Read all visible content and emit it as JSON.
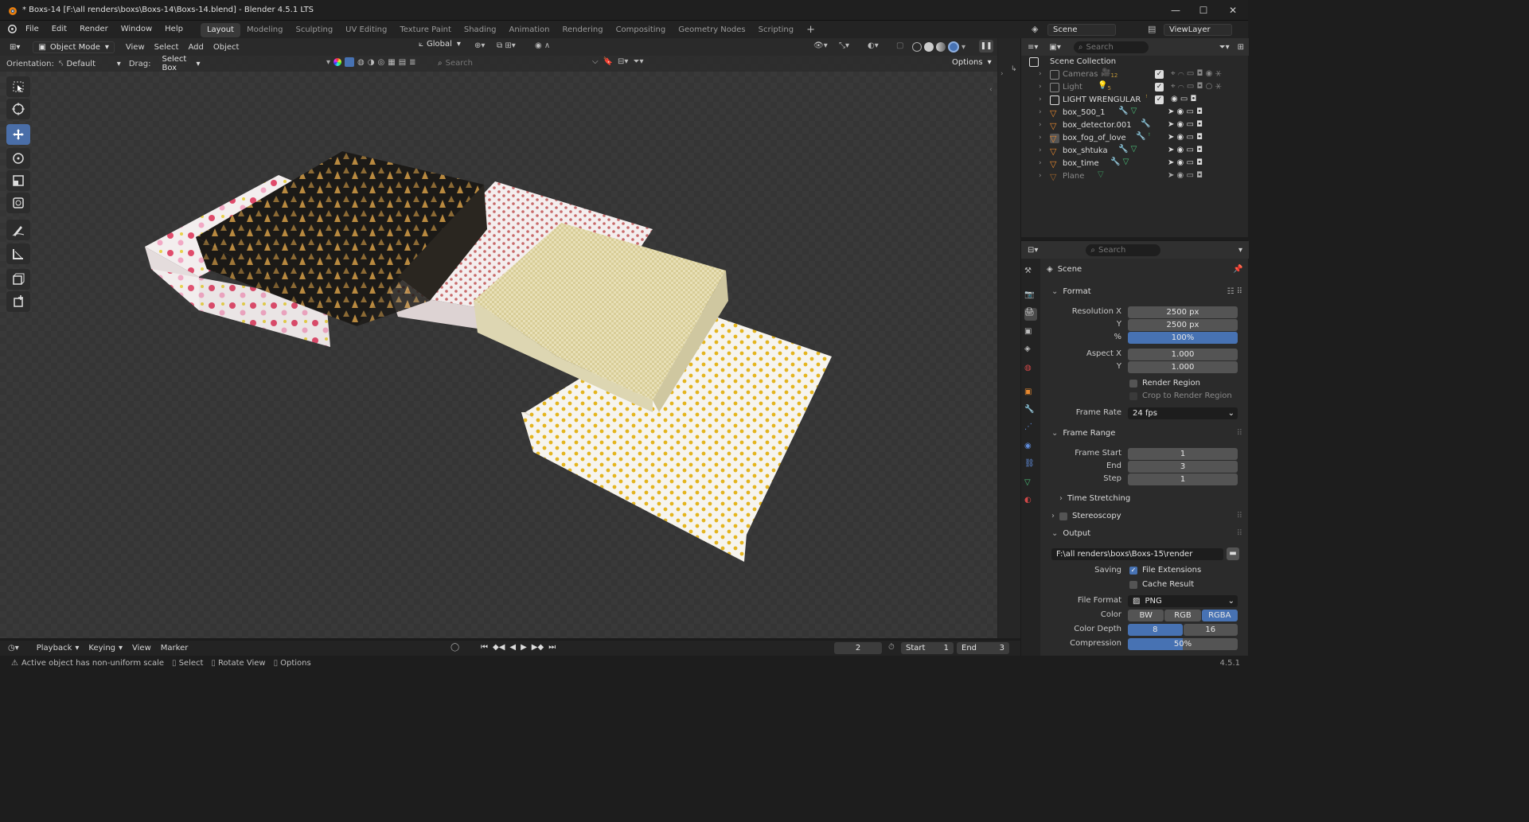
{
  "window": {
    "title": "* Boxs-14 [F:\\all renders\\boxs\\Boxs-14\\Boxs-14.blend] - Blender 4.5.1 LTS"
  },
  "menu": [
    "File",
    "Edit",
    "Render",
    "Window",
    "Help"
  ],
  "workspaces": [
    "Layout",
    "Modeling",
    "Sculpting",
    "UV Editing",
    "Texture Paint",
    "Shading",
    "Animation",
    "Rendering",
    "Compositing",
    "Geometry Nodes",
    "Scripting"
  ],
  "active_workspace": "Layout",
  "scene_selector": "Scene",
  "viewlayer_selector": "ViewLayer",
  "viewport": {
    "mode": "Object Mode",
    "menus": [
      "View",
      "Select",
      "Add",
      "Object"
    ],
    "transform_orientation": "Global",
    "orientation_label": "Orientation:",
    "orientation_value": "Default",
    "drag_label": "Drag:",
    "drag_value": "Select Box",
    "search_placeholder": "Search",
    "options_label": "Options"
  },
  "outliner": {
    "search_placeholder": "Search",
    "root": "Scene Collection",
    "items": [
      {
        "name": "Cameras",
        "badge": "12",
        "dim": true
      },
      {
        "name": "Light",
        "badge": "5",
        "dim": true
      },
      {
        "name": "LIGHT WRENGULAR",
        "dim": false
      },
      {
        "name": "box_500_1",
        "dim": false
      },
      {
        "name": "box_detector.001",
        "dim": false
      },
      {
        "name": "box_fog_of_love",
        "dim": false
      },
      {
        "name": "box_shtuka",
        "dim": false
      },
      {
        "name": "box_time",
        "dim": false
      },
      {
        "name": "Plane",
        "dim": true
      }
    ]
  },
  "properties": {
    "search_placeholder": "Search",
    "context": "Scene",
    "format": {
      "title": "Format",
      "res_x_label": "Resolution X",
      "res_x": "2500 px",
      "res_y_label": "Y",
      "res_y": "2500 px",
      "pct_label": "%",
      "pct": "100%",
      "aspect_x_label": "Aspect X",
      "aspect_x": "1.000",
      "aspect_y_label": "Y",
      "aspect_y": "1.000",
      "render_region": "Render Region",
      "crop_region": "Crop to Render Region",
      "frame_rate_label": "Frame Rate",
      "frame_rate": "24 fps"
    },
    "frame_range": {
      "title": "Frame Range",
      "start_label": "Frame Start",
      "start": "1",
      "end_label": "End",
      "end": "3",
      "step_label": "Step",
      "step": "1"
    },
    "time_stretching": "Time Stretching",
    "stereoscopy": "Stereoscopy",
    "output": {
      "title": "Output",
      "path": "F:\\all renders\\boxs\\Boxs-15\\render",
      "saving_label": "Saving",
      "file_extensions": "File Extensions",
      "cache_result": "Cache Result",
      "file_format_label": "File Format",
      "file_format": "PNG",
      "color_label": "Color",
      "color_opts": [
        "BW",
        "RGB",
        "RGBA"
      ],
      "color_active": "RGBA",
      "depth_label": "Color Depth",
      "depth_opts": [
        "8",
        "16"
      ],
      "depth_active": "8",
      "compression_label": "Compression",
      "compression": "50%"
    }
  },
  "timeline": {
    "menus": [
      "Playback",
      "Keying",
      "View",
      "Marker"
    ],
    "current_frame": "2",
    "start_label": "Start",
    "start": "1",
    "end_label": "End",
    "end": "3"
  },
  "status": {
    "warning": "Active object has non-uniform scale",
    "hints": [
      "Select",
      "Rotate View",
      "Options"
    ],
    "version": "4.5.1"
  },
  "colors": {
    "accent": "#4772b3",
    "viewport_bg": "#393939"
  }
}
